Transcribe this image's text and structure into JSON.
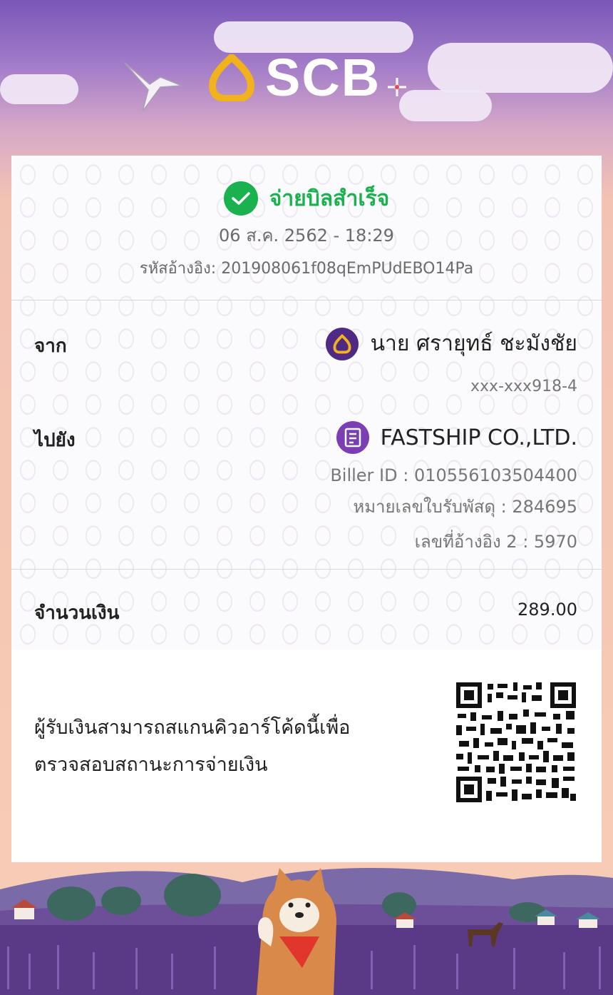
{
  "header": {
    "logo_text": "SCB",
    "brand_color": "#f2b21c"
  },
  "status": {
    "title": "จ่ายบิลสำเร็จ",
    "datetime": "06 ส.ค. 2562 - 18:29",
    "reference": "รหัสอ้างอิง: 201908061f08qEmPUdEBO14Pa",
    "color": "#1ab24f"
  },
  "from": {
    "label": "จาก",
    "name": "นาย ศรายุทธ์ ชะมังชัย",
    "account": "xxx-xxx918-4",
    "icon": "scb-bank-icon"
  },
  "to": {
    "label": "ไปยัง",
    "name": "FASTSHIP CO.,LTD.",
    "biller_id": "Biller ID : 010556103504400",
    "ref1": "หมายเลขใบรับพัสดุ : 284695",
    "ref2": "เลขที่อ้างอิง 2 : 5970",
    "icon": "biller-icon",
    "icon_color": "#7b3fb3"
  },
  "amount": {
    "label": "จำนวนเงิน",
    "value": "289.00"
  },
  "qr": {
    "text_line1": "ผู้รับเงินสามารถสแกนคิวอาร์โค้ดนี้เพื่อ",
    "text_line2": "ตรวจสอบสถานะการจ่ายเงิน",
    "icon": "qr-code-icon"
  }
}
